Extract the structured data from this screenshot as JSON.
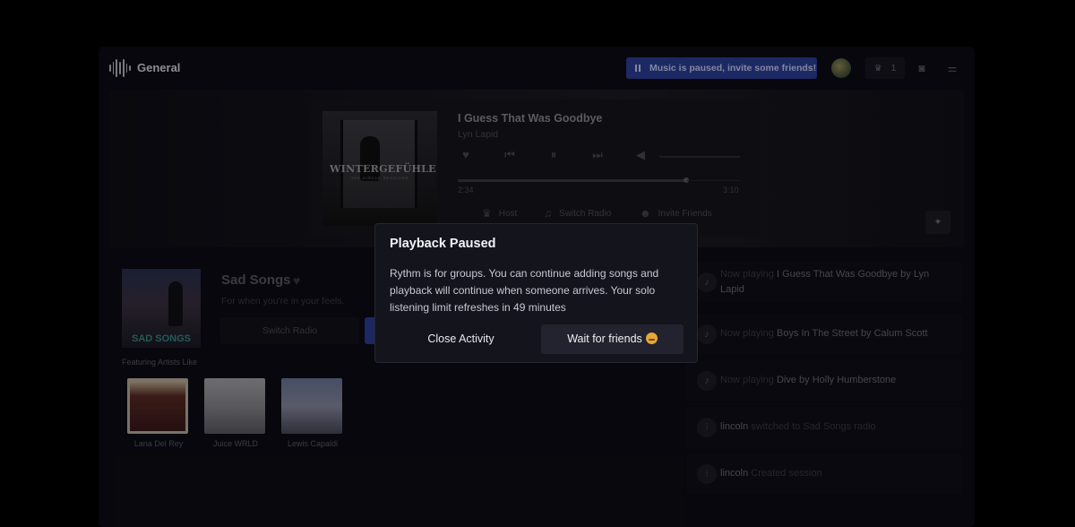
{
  "header": {
    "channel_name": "General",
    "notice": "Music is paused, invite some friends!",
    "host_count": "1"
  },
  "player": {
    "album_title": "WINTERGEFÜHLE",
    "album_subtitle": "THE CIRCLE SESSIONS",
    "track_title": "I Guess That Was Goodbye",
    "track_artist": "Lyn Lapid",
    "elapsed": "2:34",
    "duration": "3:10",
    "progress_fraction": 0.81,
    "host_label": "Host",
    "switch_radio_label": "Switch Radio",
    "invite_label": "Invite Friends"
  },
  "radio": {
    "cover_label": "SAD SONGS",
    "name": "Sad Songs",
    "description": "For when you're in your feels.",
    "switch_label": "Switch Radio",
    "featuring_label": "Featuring Artists Like",
    "artists": [
      "Lana Del Rey",
      "Juice WRLD",
      "Lewis Capaldi"
    ]
  },
  "feed": [
    {
      "prefix": "Now playing",
      "highlight": "I Guess That Was Goodbye by Lyn Lapid",
      "suffix": ""
    },
    {
      "prefix": "Now playing",
      "highlight": "Boys In The Street by Calum Scott",
      "suffix": ""
    },
    {
      "prefix": "Now playing",
      "highlight": "Dive by Holly Humberstone",
      "suffix": ""
    },
    {
      "prefix": "",
      "highlight": "lincoln",
      "suffix": "switched to Sad Songs radio"
    },
    {
      "prefix": "",
      "highlight": "lincoln",
      "suffix": "Created session"
    }
  ],
  "modal": {
    "title": "Playback Paused",
    "body": "Rythm is for groups. You can continue adding songs and playback will continue when someone arrives. Your solo listening limit refreshes in 49 minutes",
    "close_label": "Close Activity",
    "wait_label": "Wait for friends"
  },
  "colors": {
    "accent": "#2d3f9a",
    "background": "#0c0c14",
    "modal_bg": "#13141c"
  },
  "icons": [
    "rythm-logo-icon",
    "pause-icon",
    "crown-icon",
    "discord-icon",
    "equalizer-icon",
    "heart-icon",
    "previous-icon",
    "play-pause-icon",
    "next-icon",
    "volume-icon",
    "music-note-icon",
    "users-icon",
    "sparkle-icon",
    "smile-emoji-icon"
  ]
}
